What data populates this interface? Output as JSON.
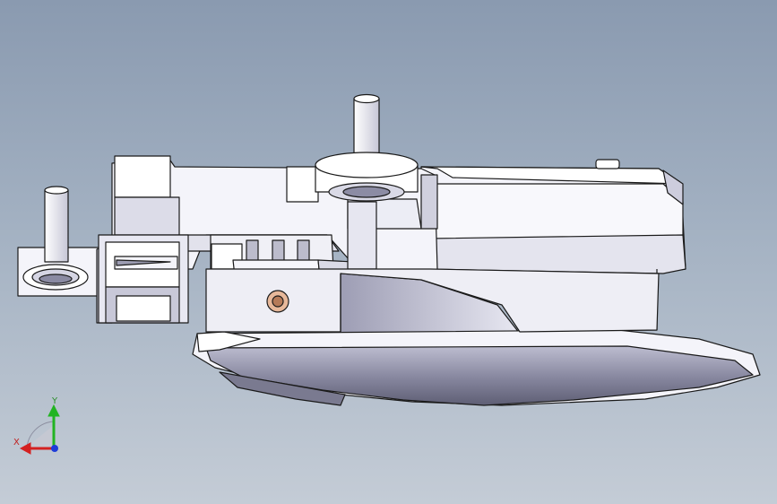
{
  "viewport": {
    "background_top": "#8a9ab0",
    "background_bottom": "#c4ccd6"
  },
  "triad": {
    "x_label": "X",
    "y_label": "Y",
    "x_color": "#d42020",
    "y_color": "#22b422",
    "z_color": "#1e3cd8"
  },
  "model": {
    "part_fill": "#f4f4fa",
    "edge_color": "#1a1a1a",
    "shade_color": "#8c8ca4",
    "dark_shade": "#5c5c70",
    "bushing_color": "#e7b89a"
  }
}
